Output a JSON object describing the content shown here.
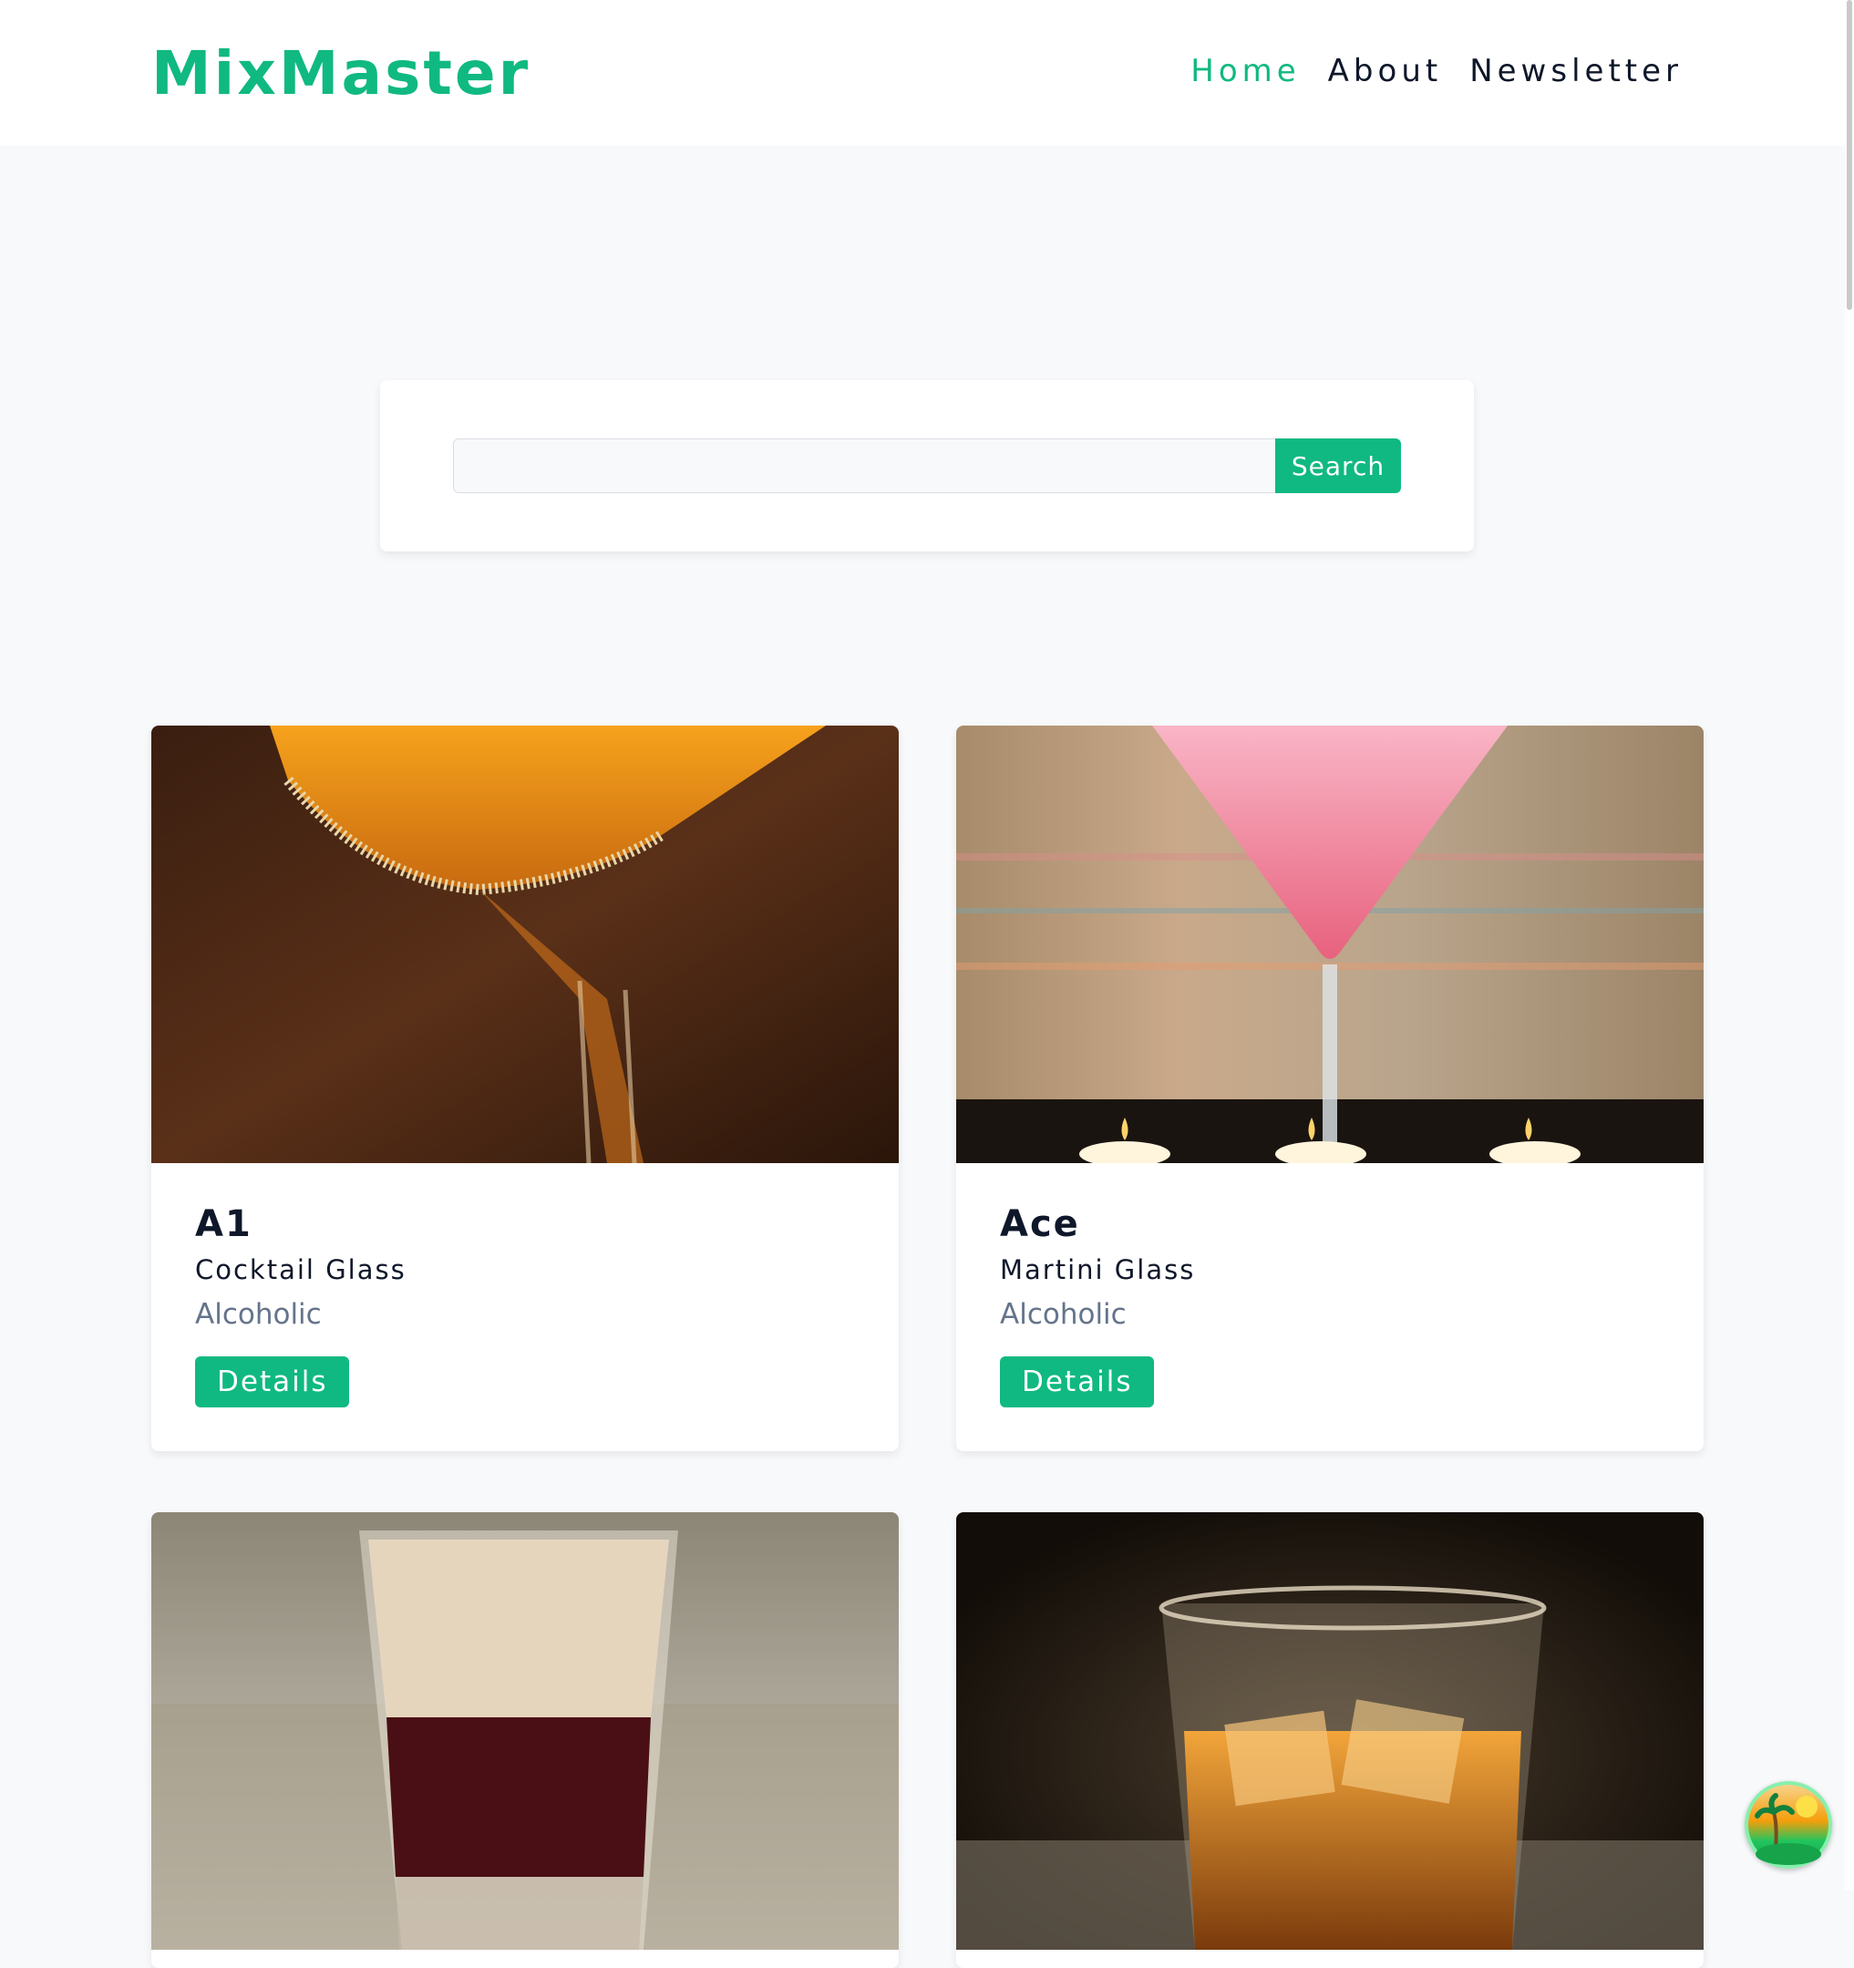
{
  "nav": {
    "logo": "MixMaster",
    "links": [
      {
        "label": "Home",
        "active": true
      },
      {
        "label": "About",
        "active": false
      },
      {
        "label": "Newsletter",
        "active": false
      }
    ]
  },
  "search": {
    "value": "",
    "placeholder": "",
    "button_label": "Search"
  },
  "cards": [
    {
      "name": "A1",
      "glass": "Cocktail Glass",
      "type": "Alcoholic",
      "button_label": "Details",
      "image": "orange-martini-sugar-rim"
    },
    {
      "name": "Ace",
      "glass": "Martini Glass",
      "type": "Alcoholic",
      "button_label": "Details",
      "image": "pink-martini-candles"
    },
    {
      "image": "layered-shot-glass"
    },
    {
      "image": "whiskey-on-the-rocks"
    }
  ],
  "colors": {
    "accent": "#10b981",
    "text": "#0f172a",
    "muted": "#64748b",
    "background": "#f8f9fb"
  },
  "icons": {
    "floating_button": "beach-island-icon"
  }
}
